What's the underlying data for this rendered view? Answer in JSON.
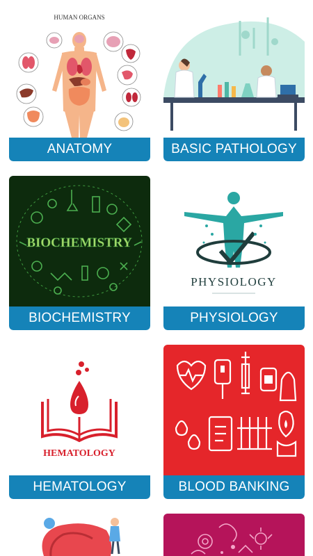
{
  "cards": [
    {
      "title": "ANATOMY",
      "art_heading": "HUMAN ORGANS",
      "icon": "human-organs-illustration"
    },
    {
      "title": "BASIC PATHOLOGY",
      "icon": "laboratory-scientists-illustration"
    },
    {
      "title": "BIOCHEMISTRY",
      "art_heading": "BIOCHEMISTRY",
      "icon": "biochemistry-illustration"
    },
    {
      "title": "PHYSIOLOGY",
      "art_heading": "PHYSIOLOGY",
      "icon": "physiology-human-figure-logo"
    },
    {
      "title": "HEMATOLOGY",
      "art_heading": "HEMATOLOGY",
      "icon": "blood-drop-book-logo"
    },
    {
      "title": "BLOOD BANKING",
      "icon": "blood-donation-equipment-illustration"
    },
    {
      "title": "",
      "icon": "medical-illustration-partial"
    },
    {
      "title": "",
      "icon": "microbiology-illustration-partial"
    }
  ],
  "colors": {
    "label_bg": "#1583b8",
    "label_text": "#ffffff",
    "biochem_bg": "#0d2b0d",
    "physio_teal": "#2aa7a3",
    "hema_red": "#d8202c",
    "blood_bank_bg": "#e5262a",
    "micro_bg": "#b5145a"
  }
}
